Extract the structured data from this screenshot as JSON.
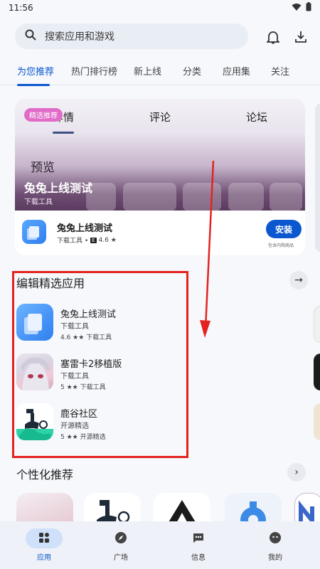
{
  "status": {
    "time": "11:56"
  },
  "search": {
    "placeholder": "搜索应用和游戏"
  },
  "tabs": [
    "为您推荐",
    "热门排行榜",
    "新上线",
    "分类",
    "应用集",
    "关注"
  ],
  "featured": {
    "badge": "精选推荐",
    "banner_tabs": [
      "详情",
      "评论",
      "论坛"
    ],
    "banner_preview": "预览",
    "banner_title": "兔兔上线测试",
    "banner_subtitle": "下载工具",
    "app_name": "兔兔上线测试",
    "app_meta_prefix": "下载工具 •",
    "rating_badge": "E",
    "rating": "4.6 ★",
    "install_label": "安装",
    "iap_note": "包含内购商品"
  },
  "editors_pick": {
    "title": "编辑精选应用",
    "apps": [
      {
        "name": "兔兔上线测试",
        "category": "下载工具",
        "meta": "4.6 ★★  下载工具"
      },
      {
        "name": "塞雷卡2移植版",
        "category": "下载工具",
        "meta": "5 ★★  下载工具"
      },
      {
        "name": "鹿谷社区",
        "category": "开源精选",
        "meta": "5 ★★  开源精选"
      }
    ]
  },
  "personalized": {
    "title": "个性化推荐"
  },
  "bottom_nav": [
    {
      "label": "应用",
      "icon": "apps-icon"
    },
    {
      "label": "广场",
      "icon": "compass-icon"
    },
    {
      "label": "信息",
      "icon": "chat-icon"
    },
    {
      "label": "我的",
      "icon": "profile-icon"
    }
  ],
  "colors": {
    "accent": "#0b57d0",
    "annotation_red": "#e3231f",
    "badge_pink": "#e06bc8"
  }
}
